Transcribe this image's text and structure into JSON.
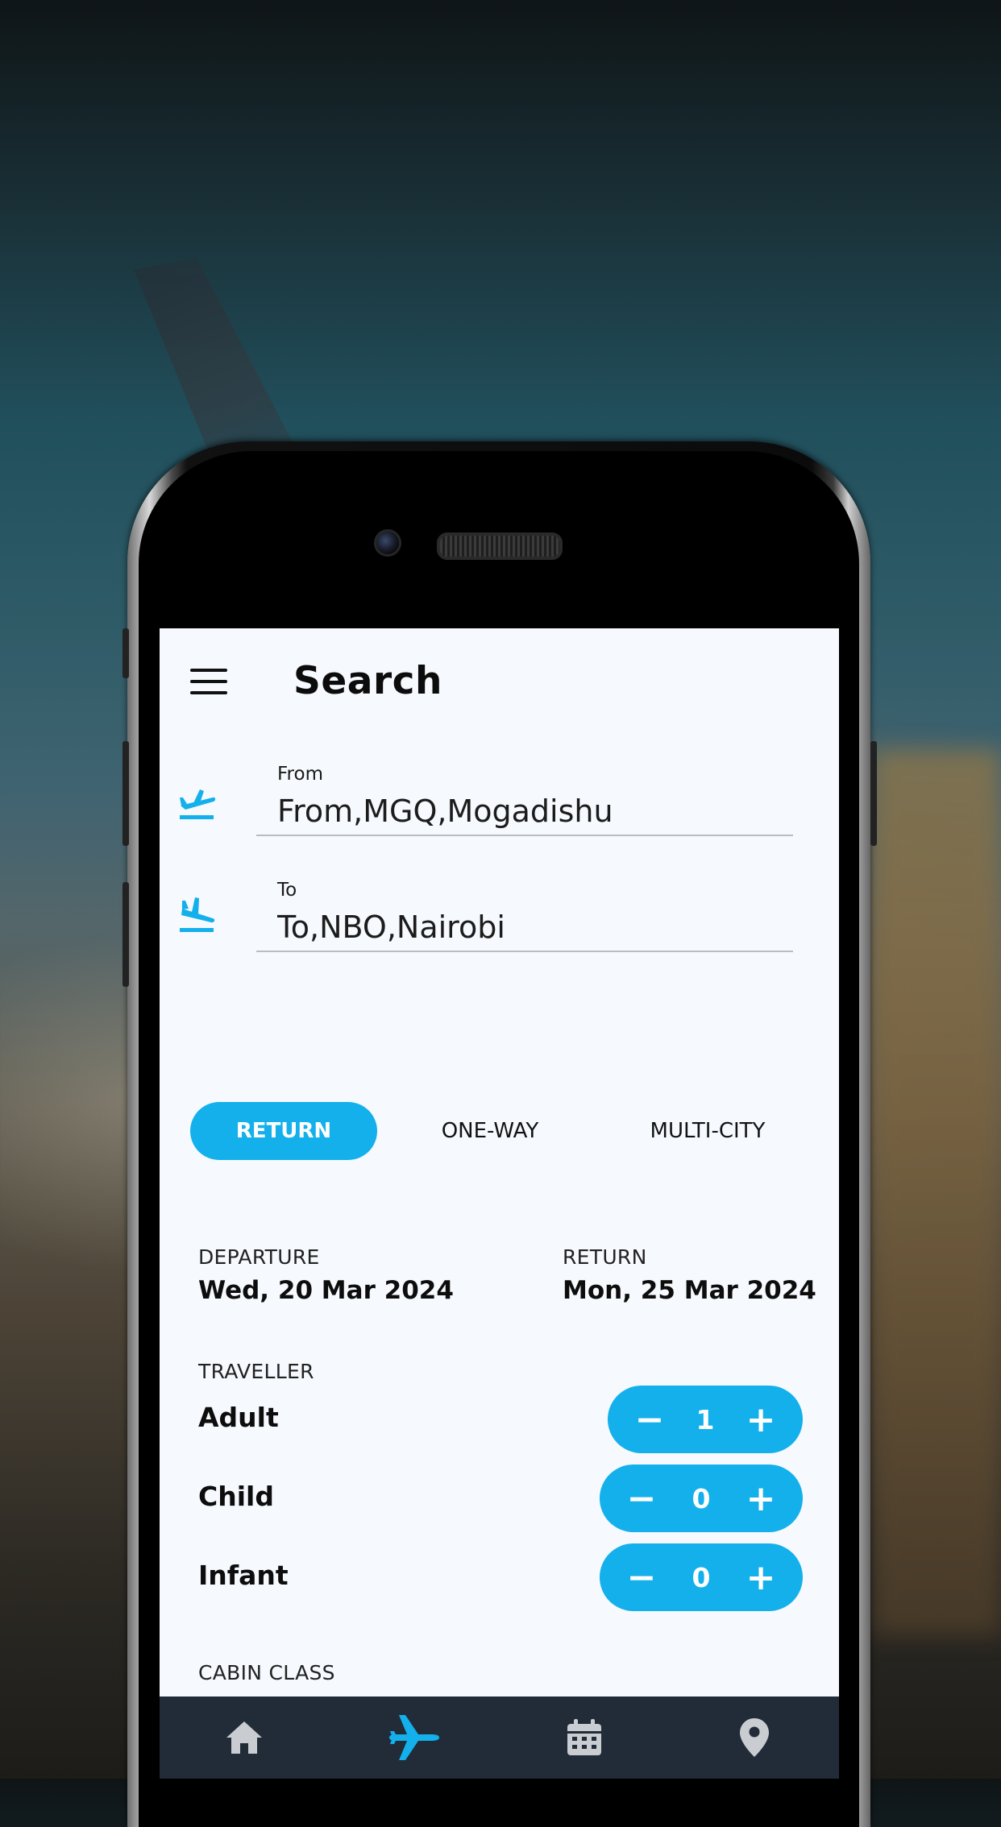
{
  "header": {
    "title": "Search"
  },
  "route": {
    "from": {
      "label": "From",
      "value": "From,MGQ,Mogadishu"
    },
    "to": {
      "label": "To",
      "value": "To,NBO,Nairobi"
    }
  },
  "trip_types": [
    {
      "label": "RETURN",
      "active": true
    },
    {
      "label": "ONE-WAY",
      "active": false
    },
    {
      "label": "MULTI-CITY",
      "active": false
    }
  ],
  "dates": {
    "departure": {
      "label": "DEPARTURE",
      "value": "Wed, 20 Mar 2024"
    },
    "return": {
      "label": "RETURN",
      "value": "Mon, 25 Mar 2024"
    }
  },
  "travellers": {
    "label": "TRAVELLER",
    "items": [
      {
        "label": "Adult",
        "count": "1"
      },
      {
        "label": "Child",
        "count": "0"
      },
      {
        "label": "Infant",
        "count": "0"
      }
    ],
    "minus_symbol": "−",
    "plus_symbol": "+"
  },
  "cabin": {
    "label": "CABIN CLASS"
  },
  "bottom_nav": [
    {
      "icon": "home-icon",
      "active": false
    },
    {
      "icon": "airplane-icon",
      "active": true
    },
    {
      "icon": "calendar-icon",
      "active": false
    },
    {
      "icon": "map-pin-icon",
      "active": false
    }
  ],
  "colors": {
    "accent": "#13b0ec",
    "nav_bg": "#222c38",
    "screen_bg": "#f6f9fd"
  }
}
